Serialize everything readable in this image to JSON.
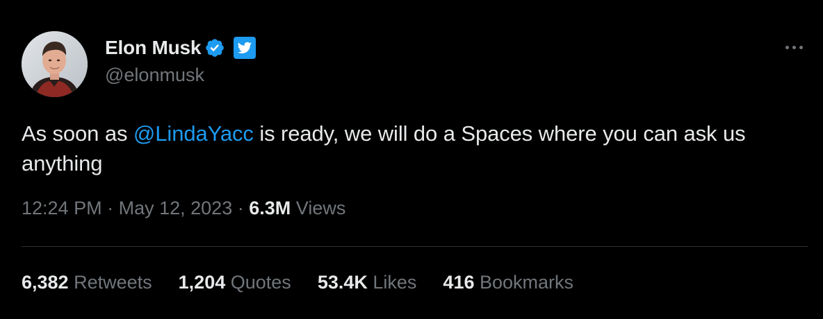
{
  "author": {
    "display_name": "Elon Musk",
    "handle": "@elonmusk",
    "verified_icon": "verified-checkmark-icon",
    "badge_icon": "twitter-bird-icon"
  },
  "tweet": {
    "text_before": "As soon as ",
    "mention": "@LindaYacc",
    "text_after": " is ready, we will do a Spaces where you can ask us anything"
  },
  "meta": {
    "time": "12:24 PM",
    "separator": "·",
    "date": "May 12, 2023",
    "views_count": "6.3M",
    "views_label": "Views"
  },
  "stats": [
    {
      "count": "6,382",
      "label": "Retweets"
    },
    {
      "count": "1,204",
      "label": "Quotes"
    },
    {
      "count": "53.4K",
      "label": "Likes"
    },
    {
      "count": "416",
      "label": "Bookmarks"
    }
  ],
  "colors": {
    "background": "#000000",
    "text": "#e7e9ea",
    "secondary": "#71767b",
    "accent": "#1d9bf0",
    "divider": "#2f3336"
  }
}
